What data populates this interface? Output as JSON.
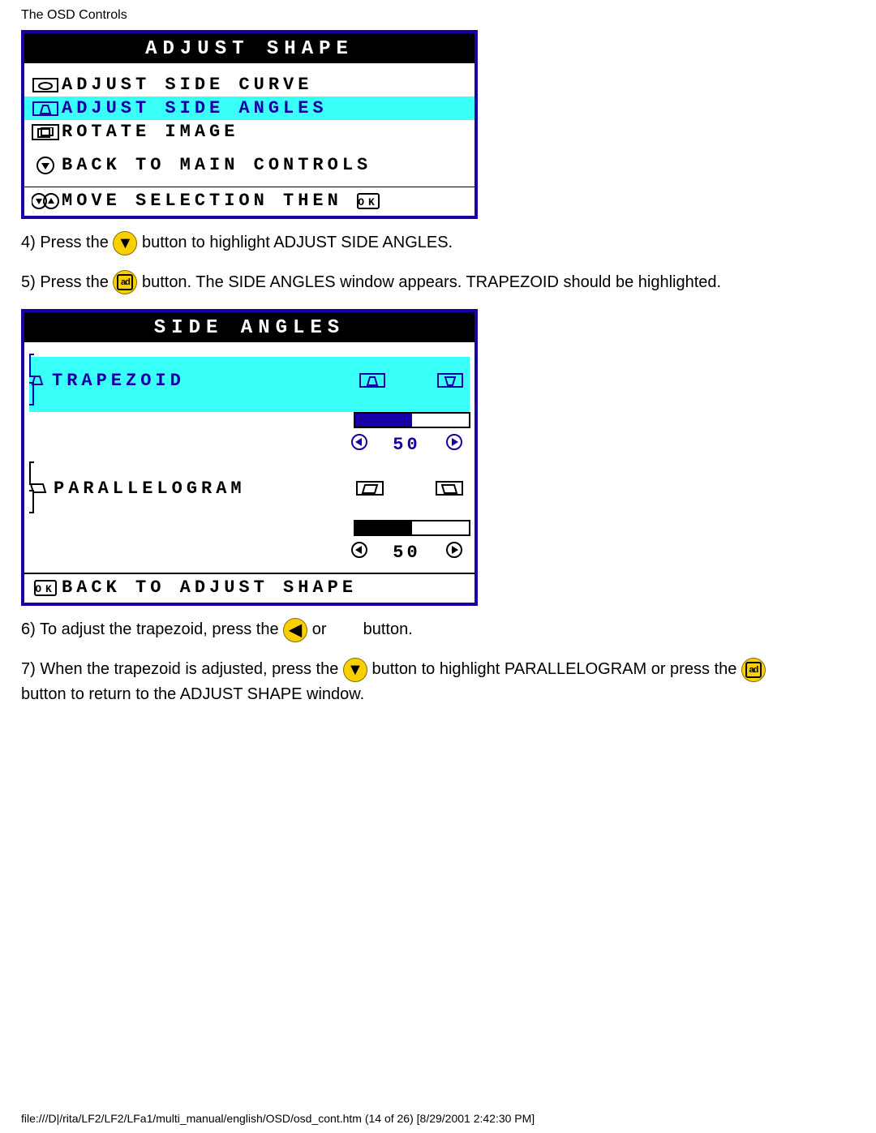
{
  "header": "The OSD Controls",
  "osd1": {
    "title": "ADJUST SHAPE",
    "items": [
      {
        "label": "ADJUST SIDE CURVE",
        "sel": false
      },
      {
        "label": "ADJUST SIDE ANGLES",
        "sel": true
      },
      {
        "label": "ROTATE IMAGE",
        "sel": false
      }
    ],
    "back": "BACK TO MAIN CONTROLS",
    "footer": "MOVE SELECTION THEN"
  },
  "step4a": "4) Press the ",
  "step4b": " button to highlight ADJUST SIDE ANGLES.",
  "step5a": "5) Press the ",
  "step5b": " button. The SIDE ANGLES window appears. TRAPEZOID should be highlighted.",
  "osd2": {
    "title": "SIDE ANGLES",
    "trapezoid": {
      "label": "TRAPEZOID",
      "value": "50"
    },
    "parallel": {
      "label": "PARALLELOGRAM",
      "value": "50"
    },
    "back": "BACK TO ADJUST SHAPE"
  },
  "step6a": "6) To adjust the trapezoid, press the ",
  "step6b": " or ",
  "step6c": " button.",
  "step7a": "7) When the trapezoid is adjusted, press the ",
  "step7b": " button to highlight PARALLELOGRAM or press the ",
  "step7c": " button to return to the ADJUST SHAPE window.",
  "footer_path": "file:///D|/rita/LF2/LF2/LFa1/multi_manual/english/OSD/osd_cont.htm (14 of 26) [8/29/2001 2:42:30 PM]"
}
